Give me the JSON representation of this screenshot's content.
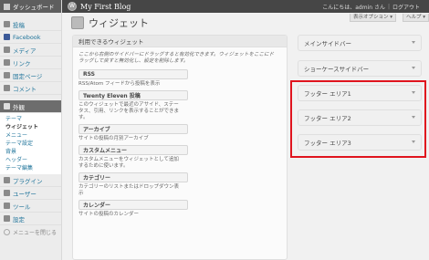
{
  "topbar": {
    "blog_title": "My First Blog",
    "greeting": "こんにちは、admin さん",
    "logout": "ログアウト"
  },
  "sidebar": {
    "dashboard": "ダッシュボード",
    "items_top": [
      {
        "label": "投稿",
        "icon": "pin-icon"
      },
      {
        "label": "Facebook",
        "icon": "facebook-icon"
      },
      {
        "label": "メディア",
        "icon": "media-icon"
      },
      {
        "label": "リンク",
        "icon": "link-icon"
      },
      {
        "label": "固定ページ",
        "icon": "page-icon"
      },
      {
        "label": "コメント",
        "icon": "comment-icon"
      }
    ],
    "active_item": {
      "label": "外観",
      "icon": "appearance-icon"
    },
    "submenu": [
      "テーマ",
      "ウィジェット",
      "メニュー",
      "テーマ設定",
      "背景",
      "ヘッダー",
      "テーマ編集"
    ],
    "submenu_current": "ウィジェット",
    "items_bottom": [
      {
        "label": "プラグイン",
        "icon": "plugin-icon"
      },
      {
        "label": "ユーザー",
        "icon": "users-icon"
      },
      {
        "label": "ツール",
        "icon": "tools-icon"
      },
      {
        "label": "設定",
        "icon": "settings-icon"
      }
    ],
    "collapse": "メニューを閉じる"
  },
  "header": {
    "title": "ウィジェット",
    "screen_options": "表示オプション ▾",
    "help": "ヘルプ ▾"
  },
  "available": {
    "heading": "利用できるウィジェット",
    "description": "ここから右側のサイドバーにドラッグすると有効化できます。ウィジェットをここにドラッグして戻すと無効化し、設定を削除します。",
    "widgets": [
      {
        "name": "RSS",
        "desc": "RSS/Atom フィードから投稿を表示"
      },
      {
        "name": "Twenty Eleven 投稿",
        "desc": "このウィジェットで最近のアサイド、ステータス、引用、リンクを表示することができます。"
      },
      {
        "name": "アーカイブ",
        "desc": "サイトの投稿の月別アーカイブ"
      },
      {
        "name": "カスタムメニュー",
        "desc": "カスタムメニューをウィジェットとして追加するために使います。"
      },
      {
        "name": "カテゴリー",
        "desc": "カテゴリーのリストまたはドロップダウン表示"
      },
      {
        "name": "カレンダー",
        "desc": "サイトの投稿のカレンダー"
      }
    ]
  },
  "sidebars": [
    "メインサイドバー",
    "ショーケースサイドバー",
    "フッター エリア1",
    "フッター エリア2",
    "フッター エリア3"
  ],
  "colors": {
    "highlight": "#e0141e",
    "link": "#21759b",
    "active_menu": "#6d6d6d"
  }
}
